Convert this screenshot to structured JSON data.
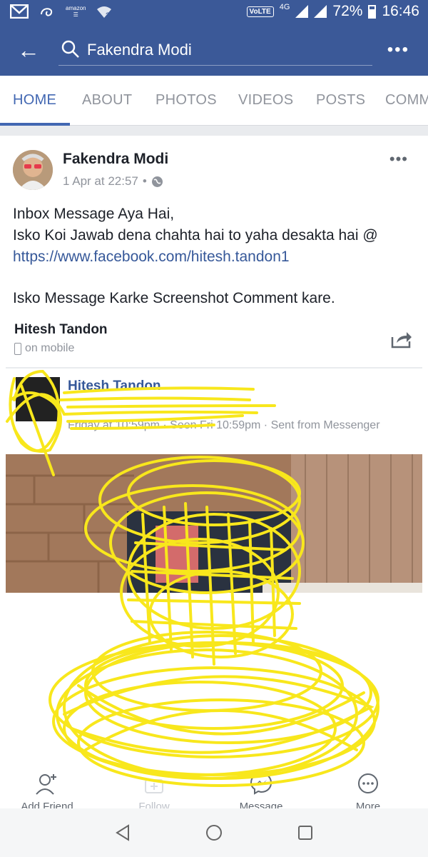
{
  "status_bar": {
    "amazon": "amazon",
    "volte": "VoLTE",
    "network": "4G",
    "battery": "72%",
    "time": "16:46"
  },
  "search": {
    "value": "Fakendra Modi"
  },
  "tabs": [
    {
      "label": "HOME",
      "active": true
    },
    {
      "label": "ABOUT"
    },
    {
      "label": "PHOTOS"
    },
    {
      "label": "VIDEOS"
    },
    {
      "label": "POSTS"
    },
    {
      "label": "COMM"
    }
  ],
  "post": {
    "author": "Fakendra Modi",
    "date": "1 Apr at 22:57",
    "separator": "•",
    "lines": [
      "Inbox Message Aya Hai,",
      "Isko Koi Jawab dena chahta hai to yaha desakta hai @",
      "https://www.facebook.com/hitesh.tandon1",
      "Isko Message Karke Screenshot Comment kare."
    ],
    "tagged_name": "Hitesh Tandon",
    "tagged_sub": "on mobile"
  },
  "shared": {
    "name": "Hitesh Tandon",
    "meta": "Friday at 10:59pm · Seen Fri 10:59pm · Sent from Messenger"
  },
  "actions": [
    {
      "label": "Add Friend",
      "icon": "add-friend-icon"
    },
    {
      "label": "Follow",
      "icon": "follow-icon"
    },
    {
      "label": "Message",
      "icon": "messenger-icon"
    },
    {
      "label": "More",
      "icon": "more-icon"
    }
  ],
  "colors": {
    "facebook_blue": "#3b5998",
    "link": "#365899",
    "scribble": "#f8e71c"
  }
}
